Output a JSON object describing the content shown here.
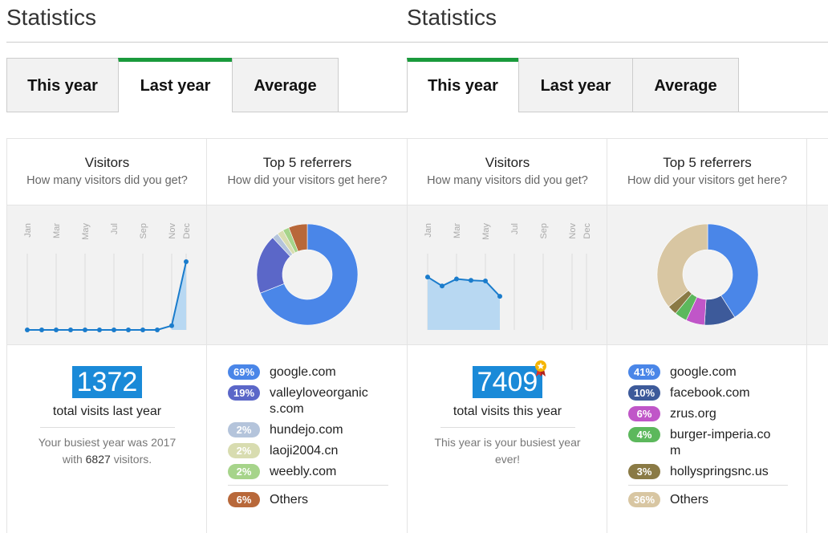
{
  "left": {
    "title": "Statistics",
    "tabs": [
      {
        "label": "This year",
        "active": false
      },
      {
        "label": "Last year",
        "active": true
      },
      {
        "label": "Average",
        "active": false
      }
    ],
    "visitors": {
      "heading": "Visitors",
      "subheading": "How many visitors did you get?",
      "total": "1372",
      "total_label": "total visits last year",
      "note_prefix": "Your busiest year was 2017",
      "note_with": "with",
      "note_count": "6827",
      "note_suffix": "visitors."
    },
    "referrers": {
      "heading": "Top 5 referrers",
      "subheading": "How did your visitors get here?",
      "items": [
        {
          "pct": "69%",
          "name": "google.com",
          "color": "#4a86e8"
        },
        {
          "pct": "19%",
          "name": "valleyloveorganics.com",
          "color": "#5b67c8"
        },
        {
          "pct": "2%",
          "name": "hundejo.com",
          "color": "#b4c4db"
        },
        {
          "pct": "2%",
          "name": "laoji2004.cn",
          "color": "#d8dcb0"
        },
        {
          "pct": "2%",
          "name": "weebly.com",
          "color": "#a6d48a"
        }
      ],
      "others": {
        "pct": "6%",
        "name": "Others",
        "color": "#b8683a"
      }
    }
  },
  "right": {
    "title": "Statistics",
    "tabs": [
      {
        "label": "This year",
        "active": true
      },
      {
        "label": "Last year",
        "active": false
      },
      {
        "label": "Average",
        "active": false
      }
    ],
    "visitors": {
      "heading": "Visitors",
      "subheading": "How many visitors did you get?",
      "total": "7409",
      "total_label": "total visits this year",
      "note": "This year is your busiest year ever!"
    },
    "referrers": {
      "heading": "Top 5 referrers",
      "subheading": "How did your visitors get here?",
      "items": [
        {
          "pct": "41%",
          "name": "google.com",
          "color": "#4a86e8"
        },
        {
          "pct": "10%",
          "name": "facebook.com",
          "color": "#3d5a9a"
        },
        {
          "pct": "6%",
          "name": "zrus.org",
          "color": "#c056c8"
        },
        {
          "pct": "4%",
          "name": "burger-imperia.com",
          "color": "#5cb85c"
        },
        {
          "pct": "3%",
          "name": "hollyspringsnc.us",
          "color": "#8a7a45"
        }
      ],
      "others": {
        "pct": "36%",
        "name": "Others",
        "color": "#d8c6a2"
      }
    }
  },
  "chart_data": [
    {
      "type": "line",
      "categories": [
        "Jan",
        "Feb",
        "Mar",
        "Apr",
        "May",
        "Jun",
        "Jul",
        "Aug",
        "Sep",
        "Oct",
        "Nov",
        "Dec"
      ],
      "tick_labels": [
        "Jan",
        "Mar",
        "May",
        "Jul",
        "Sep",
        "Nov",
        "Dec"
      ],
      "values": [
        0,
        0,
        0,
        0,
        0,
        0,
        0,
        0,
        0,
        0,
        80,
        1292
      ],
      "color": "#1a7ccc"
    },
    {
      "type": "pie",
      "labels": [
        "google.com",
        "valleyloveorganics.com",
        "hundejo.com",
        "laoji2004.cn",
        "weebly.com",
        "Others"
      ],
      "values": [
        69,
        19,
        2,
        2,
        2,
        6
      ],
      "colors": [
        "#4a86e8",
        "#5b67c8",
        "#b4c4db",
        "#d8dcb0",
        "#a6d48a",
        "#b8683a"
      ]
    },
    {
      "type": "area",
      "categories": [
        "Jan",
        "Feb",
        "Mar",
        "Apr",
        "May",
        "Jun",
        "Jul",
        "Aug",
        "Sep",
        "Oct",
        "Nov",
        "Dec"
      ],
      "tick_labels": [
        "Jan",
        "Mar",
        "May",
        "Jul",
        "Sep",
        "Nov",
        "Dec"
      ],
      "values": [
        1590,
        1320,
        1530,
        1490,
        1470,
        1010
      ],
      "color": "#1a7ccc"
    },
    {
      "type": "pie",
      "labels": [
        "google.com",
        "facebook.com",
        "zrus.org",
        "burger-imperia.com",
        "hollyspringsnc.us",
        "Others"
      ],
      "values": [
        41,
        10,
        6,
        4,
        3,
        36
      ],
      "colors": [
        "#4a86e8",
        "#3d5a9a",
        "#c056c8",
        "#5cb85c",
        "#8a7a45",
        "#d8c6a2"
      ]
    }
  ]
}
